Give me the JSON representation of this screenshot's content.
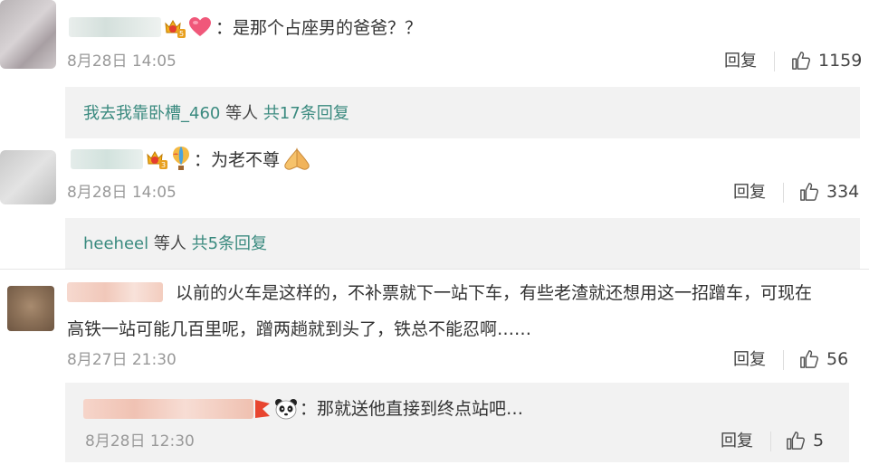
{
  "comments": [
    {
      "text": "：是那个占座男的爸爸？？",
      "time": "8月28日 14:05",
      "reply_label": "回复",
      "likes": "1159",
      "thread": {
        "user": "我去我靠卧槽_460",
        "mid": " 等人 ",
        "total": "共17条回复"
      }
    },
    {
      "text": "：为老不尊",
      "time": "8月28日 14:05",
      "reply_label": "回复",
      "likes": "334",
      "thread": {
        "user": "heeheel",
        "mid": " 等人 ",
        "total": "共5条回复"
      }
    },
    {
      "text_line1": "以前的火车是这样的，不补票就下一站下车，有些老渣就还想用这一招蹭车，可现在",
      "text_line2": "高铁一站可能几百里呢，蹭两趟就到头了，铁总不能忍啊……",
      "time": "8月27日 21:30",
      "reply_label": "回复",
      "likes": "56",
      "reply": {
        "text": "：那就送他直接到终点站吧…",
        "time": "8月28日 12:30",
        "reply_label": "回复",
        "likes": "5"
      }
    }
  ],
  "icons": [
    "thumbs-up-icon",
    "crown-badge-icon",
    "heart-icon",
    "balloon-icon",
    "clasped-hands-icon",
    "panda-icon",
    "red-flag-icon"
  ],
  "colors": {
    "link": "#3a8a7f",
    "meta": "#999999",
    "sub_bg": "#f2f2f2"
  }
}
